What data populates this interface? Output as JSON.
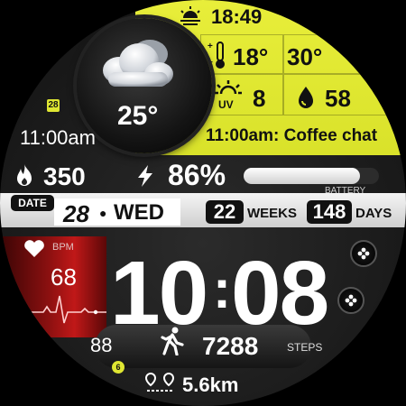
{
  "top": {
    "sunset_time": "18:49",
    "temp_low": "18°",
    "temp_high": "30°",
    "uv": "8",
    "humidity": "58",
    "event": "11:00am: Coffee chat"
  },
  "weather": {
    "current_temp": "25°"
  },
  "calendar": {
    "day_badge": "28",
    "event_time": "11:00am"
  },
  "stats": {
    "calories": "350",
    "battery_pct": "86%",
    "battery_level": 0.86,
    "battery_label": "BATTERY"
  },
  "date": {
    "label": "DATE",
    "day_num": "28",
    "weekday": "WED",
    "weeks_num": "22",
    "weeks_label": "WEEKS",
    "days_num": "148",
    "days_label": "DAYS"
  },
  "heart": {
    "label": "BPM",
    "value": "68"
  },
  "time": {
    "hours": "10",
    "minutes": "08",
    "separator": ":"
  },
  "steps": {
    "value": "7288",
    "label": "STEPS"
  },
  "extra": {
    "value": "88",
    "badge": "6"
  },
  "distance": {
    "value": "5.6km"
  },
  "colors": {
    "accent": "#dfe632",
    "red": "#c01818"
  }
}
